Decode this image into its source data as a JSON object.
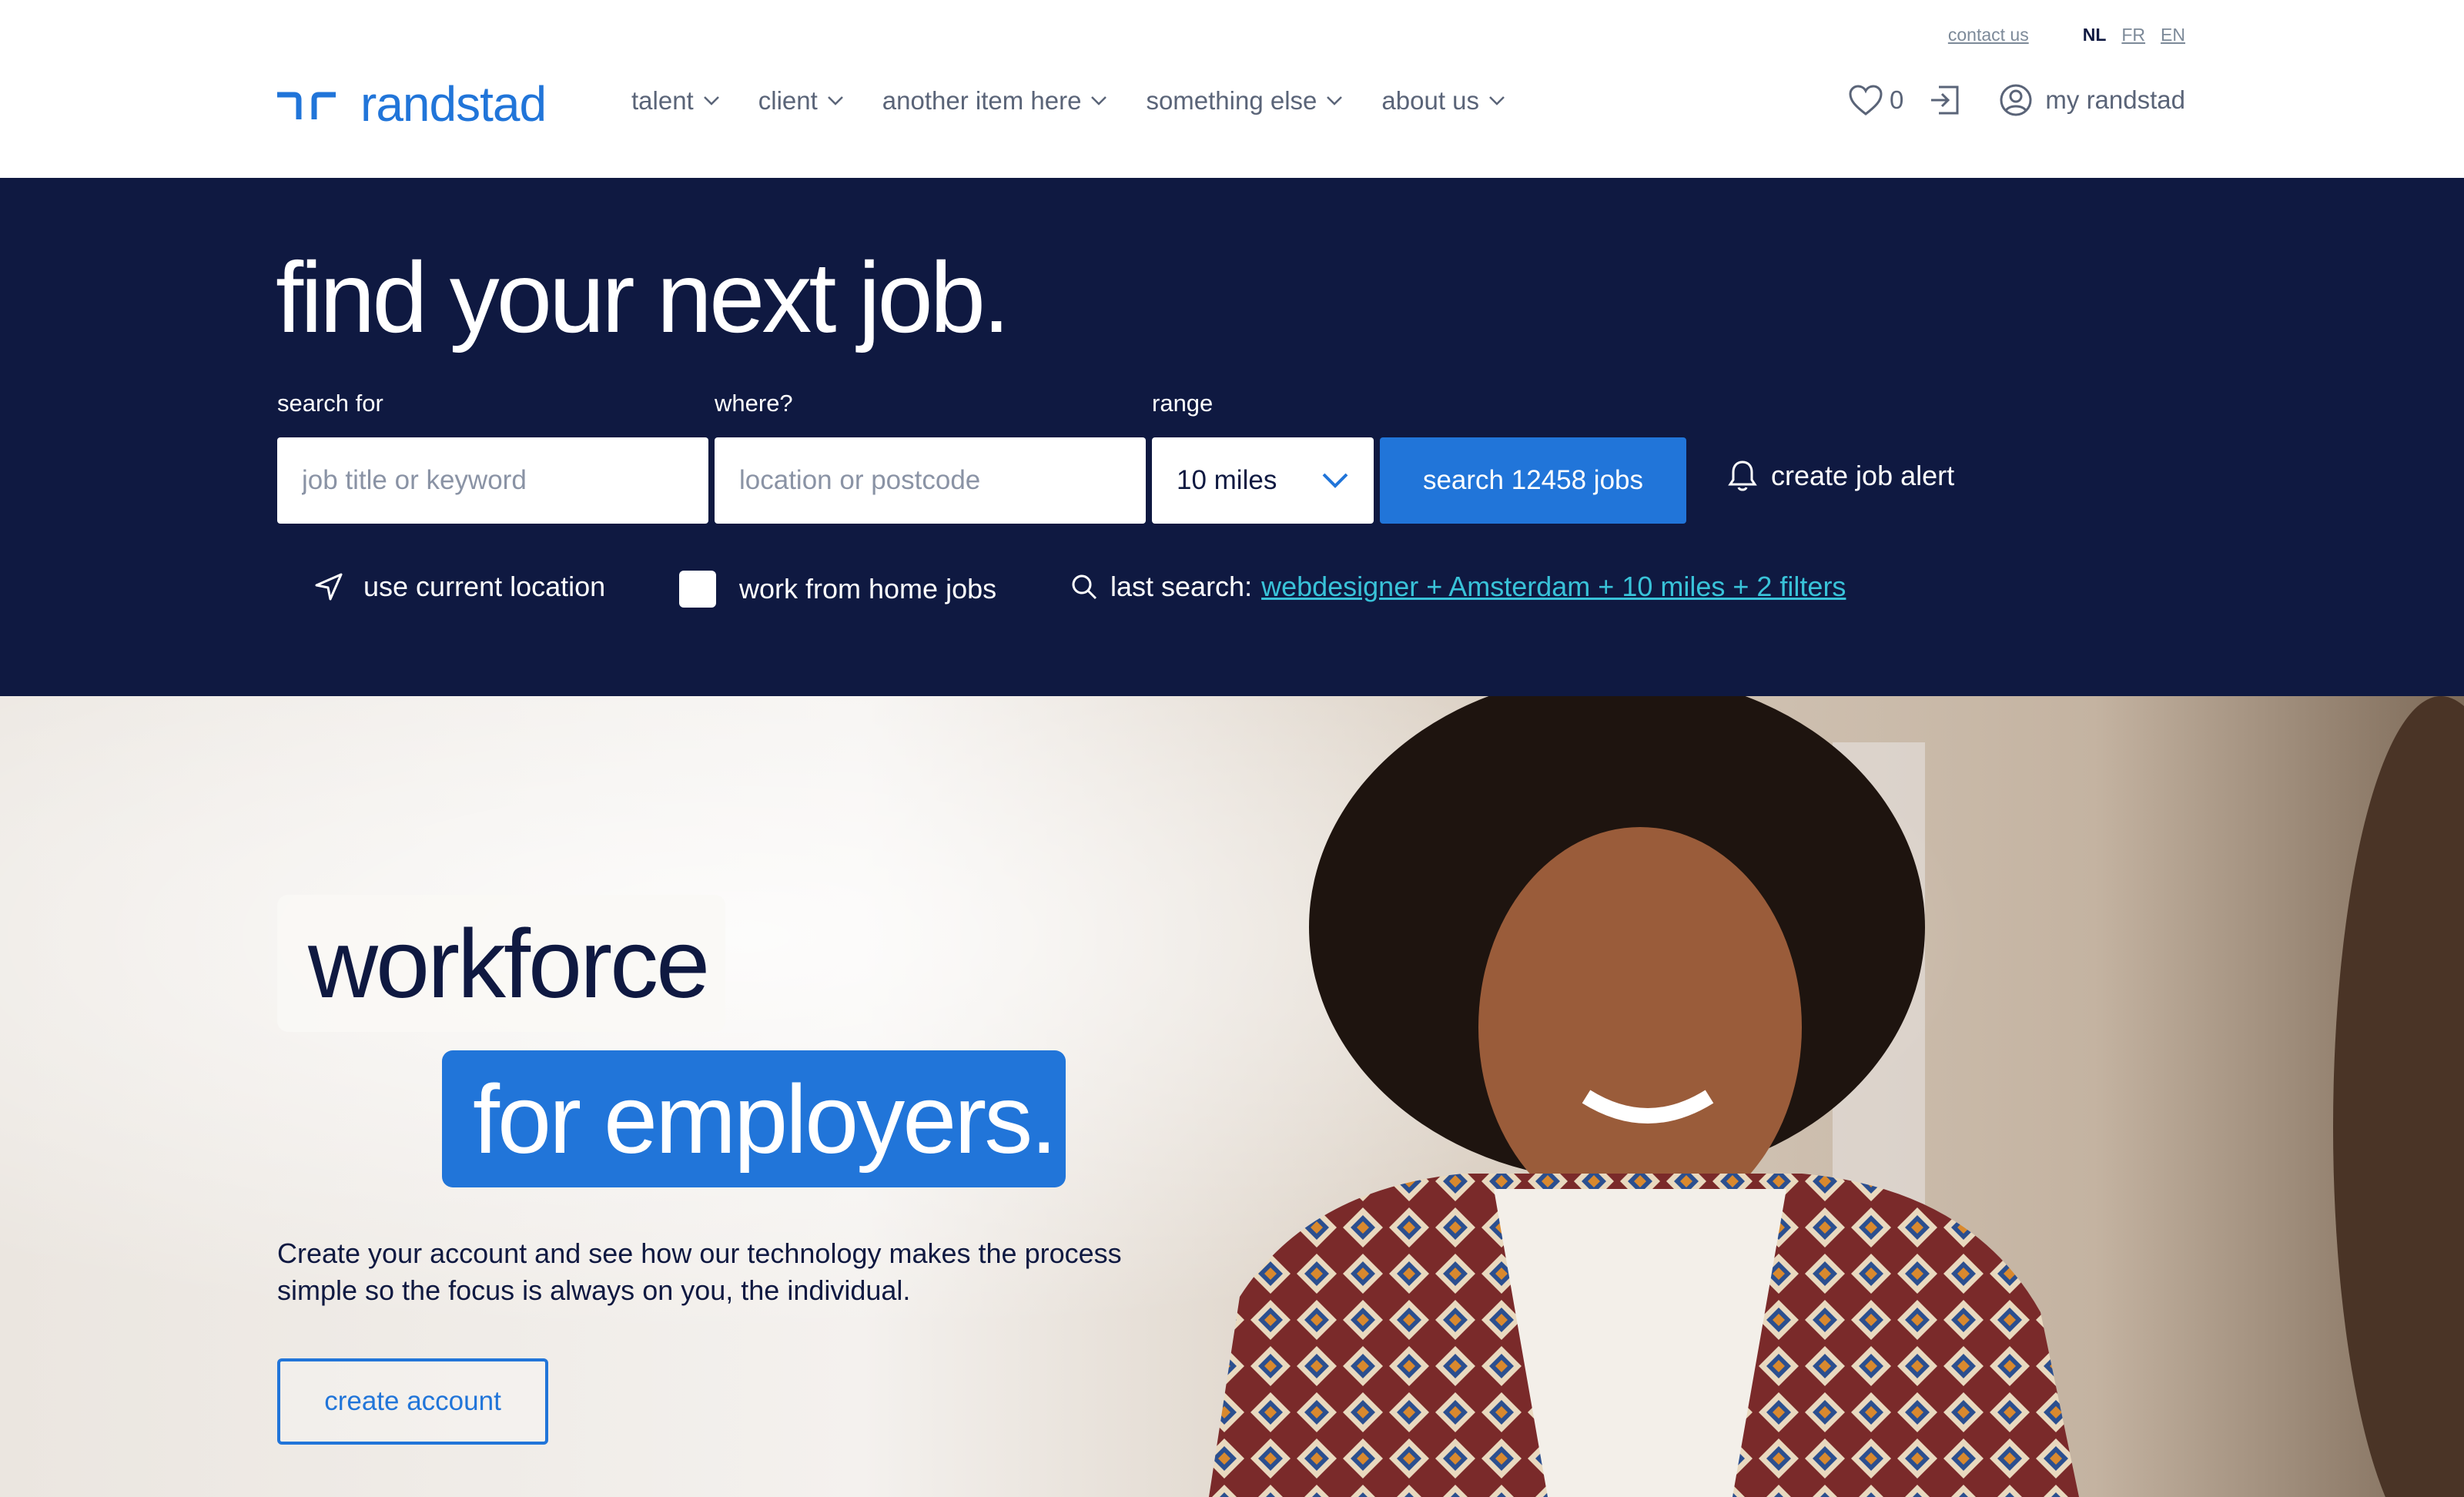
{
  "utility": {
    "contact": "contact us",
    "languages": [
      "NL",
      "FR",
      "EN"
    ]
  },
  "brand": {
    "name": "randstad",
    "logo_color": "#2175d9"
  },
  "nav": {
    "items": [
      {
        "label": "talent"
      },
      {
        "label": "client"
      },
      {
        "label": "another item here"
      },
      {
        "label": "something else"
      },
      {
        "label": "about us"
      }
    ]
  },
  "header_right": {
    "favorites_count": "0",
    "account_label": "my randstad",
    "icons": [
      "heart-icon",
      "login-icon",
      "user-circle-icon"
    ]
  },
  "search": {
    "headline": "find your next job.",
    "keyword_label": "search for",
    "keyword_placeholder": "job title or keyword",
    "location_label": "where?",
    "location_placeholder": "location or postcode",
    "range_label": "range",
    "range_value": "10 miles",
    "search_button": "search 12458 jobs",
    "alert_label": "create job alert",
    "use_location": "use current location",
    "wfh_label": "work from home jobs",
    "last_search_label": "last search:",
    "last_search_link": "webdesigner + Amsterdam  + 10 miles + 2 filters"
  },
  "hero": {
    "tag_primary": "workforce",
    "tag_secondary": "for employers.",
    "text": "Create your account and see how our technology makes the process simple so the focus is always on you, the individual.",
    "cta": "create account"
  },
  "colors": {
    "navy": "#0f1941",
    "blue": "#2175d9",
    "link_cyan": "#39c3d9"
  }
}
